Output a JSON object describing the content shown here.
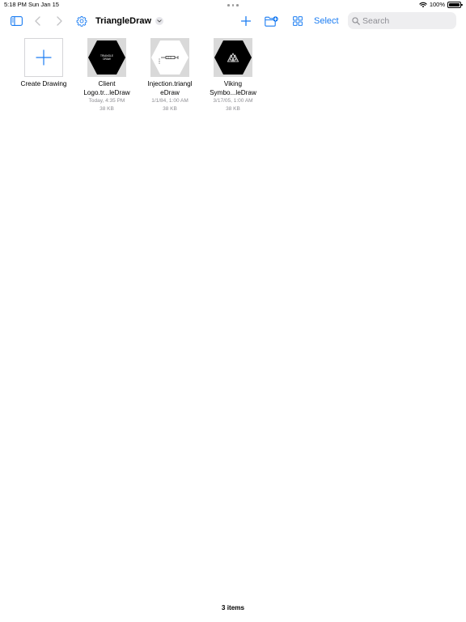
{
  "status_bar": {
    "time": "5:18 PM",
    "date": "Sun Jan 15",
    "battery": "100%"
  },
  "toolbar": {
    "title": "TriangleDraw",
    "select_label": "Select",
    "search_placeholder": "Search"
  },
  "files": {
    "create": {
      "label": "Create Drawing"
    },
    "items": [
      {
        "name_line1": "Client",
        "name_line2": "Logo.tr...leDraw",
        "date": "Today, 4:35 PM",
        "size": "38 KB",
        "thumb_text_1": "TRIANGLE",
        "thumb_text_2": "DRAW"
      },
      {
        "name_line1": "Injection.triangl",
        "name_line2": "eDraw",
        "date": "1/1/84, 1:00 AM",
        "size": "38 KB"
      },
      {
        "name_line1": "Viking",
        "name_line2": "Symbo...leDraw",
        "date": "3/17/05, 1:00 AM",
        "size": "38 KB"
      }
    ]
  },
  "footer": {
    "item_count": "3 items"
  },
  "colors": {
    "accent": "#1a7cf2",
    "secondary_text": "#8e8e93",
    "thumb_background": "#d9d9d9"
  }
}
